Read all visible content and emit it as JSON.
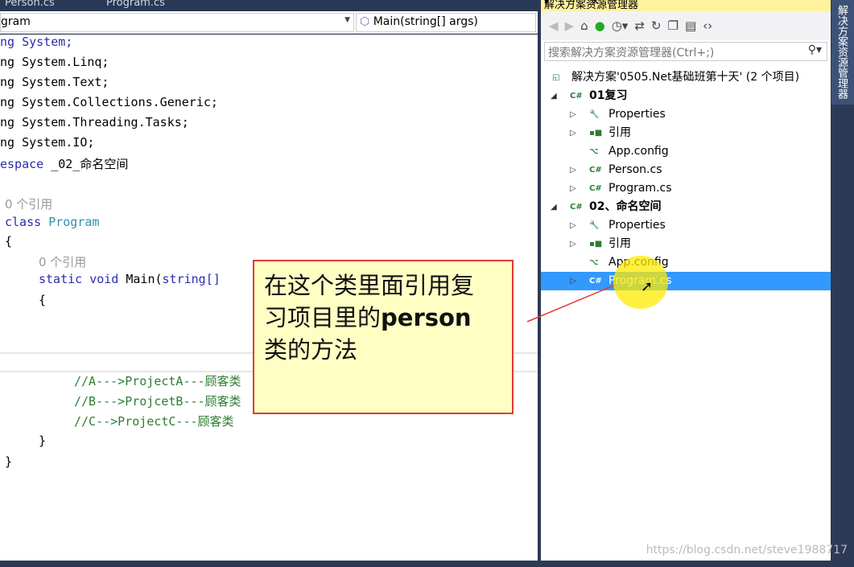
{
  "tabs": [
    "Person.cs",
    "Program.cs"
  ],
  "nav": {
    "class": "gram",
    "member": "Main(string[] args)"
  },
  "code": {
    "l1": "ng System;",
    "l2": "ng System.Linq;",
    "l3": "ng System.Text;",
    "l4": "ng System.Collections.Generic;",
    "l5": "ng System.Threading.Tasks;",
    "l6": "ng System.IO;",
    "l7a": "espace",
    "l7b": " _02_命名空间",
    "ref1": "0 个引用",
    "cls_kw": "class ",
    "cls_name": "Program",
    "brace_open": "{",
    "ref2": "0 个引用",
    "main_kw": "static void ",
    "main_name": "Main(",
    "main_type": "string[]",
    "c1": "//A--->ProjectA---顾客类",
    "c2": "//B--->ProjcetB---顾客类",
    "c3": "//C-->ProjectC---顾客类",
    "brace_close": "}"
  },
  "panel": {
    "title": "解决方案资源管理器",
    "title_buttons": "▾ ⊣ ✕",
    "search_placeholder": "搜索解决方案资源管理器(Ctrl+;)",
    "tree": [
      {
        "label": "解决方案'0505.Net基础班第十天' (2 个项目)",
        "icon": "solution-icon"
      },
      {
        "label": "01复习",
        "icon": "csproj-icon",
        "exp": "◢"
      },
      {
        "label": "Properties",
        "icon": "wrench-icon",
        "exp": "▷"
      },
      {
        "label": "引用",
        "icon": "references-icon",
        "exp": "▷"
      },
      {
        "label": "App.config",
        "icon": "config-icon"
      },
      {
        "label": "Person.cs",
        "icon": "csharp-file-icon",
        "exp": "▷"
      },
      {
        "label": "Program.cs",
        "icon": "csharp-file-icon",
        "exp": "▷"
      },
      {
        "label": "02、命名空间",
        "icon": "csproj-icon",
        "exp": "◢"
      },
      {
        "label": "Properties",
        "icon": "wrench-icon",
        "exp": "▷"
      },
      {
        "label": "引用",
        "icon": "references-icon",
        "exp": "▷"
      },
      {
        "label": "App.config",
        "icon": "config-icon"
      },
      {
        "label": "Program.cs",
        "icon": "csharp-file-icon",
        "exp": "▷",
        "selected": true
      }
    ]
  },
  "side_tab": "解决方案资源管理器",
  "callout": {
    "line1": "在这个类里面引用复",
    "line2a": "习项目里的",
    "line2b": "person",
    "line3": "类的方法"
  },
  "watermark": "https://blog.csdn.net/steve1988717"
}
